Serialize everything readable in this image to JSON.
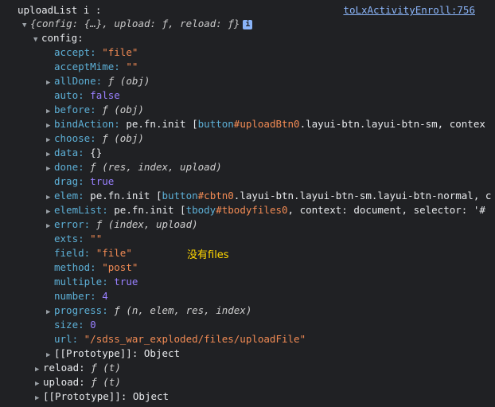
{
  "header": {
    "label": "uploadList i :",
    "source_link": "toLxActivityEnroll:756"
  },
  "summary": "{config: {…}, upload: ƒ, reload: ƒ}",
  "rows": [
    {
      "indent": 0,
      "arrow": "",
      "key": "uploadList i :",
      "value": ""
    },
    {
      "indent": 1,
      "arrow": "▼",
      "key": "config:",
      "value": ""
    },
    {
      "indent": 3,
      "arrow": "",
      "key": "accept:",
      "value": "\"file\""
    },
    {
      "indent": 3,
      "arrow": "",
      "key": "acceptMime:",
      "value": "\"\""
    },
    {
      "indent": 3,
      "arrow": "▶",
      "key": "allDone:",
      "value": "ƒ (obj)"
    },
    {
      "indent": 3,
      "arrow": "",
      "key": "auto:",
      "value": "false"
    },
    {
      "indent": 3,
      "arrow": "▶",
      "key": "before:",
      "value": "ƒ (obj)"
    },
    {
      "indent": 3,
      "arrow": "▶",
      "key": "bindAction:",
      "value": "pe.fn.init [button#uploadBtn0.layui-btn.layui-btn-sm, contex"
    },
    {
      "indent": 3,
      "arrow": "▶",
      "key": "choose:",
      "value": "ƒ (obj)"
    },
    {
      "indent": 3,
      "arrow": "▶",
      "key": "data:",
      "value": "{}"
    },
    {
      "indent": 3,
      "arrow": "▶",
      "key": "done:",
      "value": "ƒ (res, index, upload)"
    },
    {
      "indent": 3,
      "arrow": "",
      "key": "drag:",
      "value": "true"
    },
    {
      "indent": 3,
      "arrow": "▶",
      "key": "elem:",
      "value": "pe.fn.init [button#cbtn0.layui-btn.layui-btn-sm.layui-btn-normal, c"
    },
    {
      "indent": 3,
      "arrow": "▶",
      "key": "elemList:",
      "value": "pe.fn.init [tbody#tbodyfiles0, context: document, selector: '#"
    },
    {
      "indent": 3,
      "arrow": "▶",
      "key": "error:",
      "value": "ƒ (index, upload)"
    },
    {
      "indent": 3,
      "arrow": "",
      "key": "exts:",
      "value": "\"\""
    },
    {
      "indent": 3,
      "arrow": "",
      "key": "field:",
      "value": "\"file\""
    },
    {
      "indent": 3,
      "arrow": "",
      "key": "method:",
      "value": "\"post\""
    },
    {
      "indent": 3,
      "arrow": "",
      "key": "multiple:",
      "value": "true"
    },
    {
      "indent": 3,
      "arrow": "",
      "key": "number:",
      "value": "4"
    },
    {
      "indent": 3,
      "arrow": "▶",
      "key": "progress:",
      "value": "ƒ (n, elem, res, index)"
    },
    {
      "indent": 3,
      "arrow": "",
      "key": "size:",
      "value": "0"
    },
    {
      "indent": 3,
      "arrow": "",
      "key": "url:",
      "value": "\"/sdss_war_exploded/files/uploadFile\""
    },
    {
      "indent": 3,
      "arrow": "▶",
      "key": "[[Prototype]]:",
      "value": "Object"
    },
    {
      "indent": 2,
      "arrow": "▶",
      "key": "reload:",
      "value": "ƒ (t)"
    },
    {
      "indent": 2,
      "arrow": "▶",
      "key": "upload:",
      "value": "ƒ (t)"
    },
    {
      "indent": 2,
      "arrow": "▶",
      "key": "[[Prototype]]:",
      "value": "Object"
    }
  ],
  "annotation": "没有files",
  "info_icon_label": "i"
}
